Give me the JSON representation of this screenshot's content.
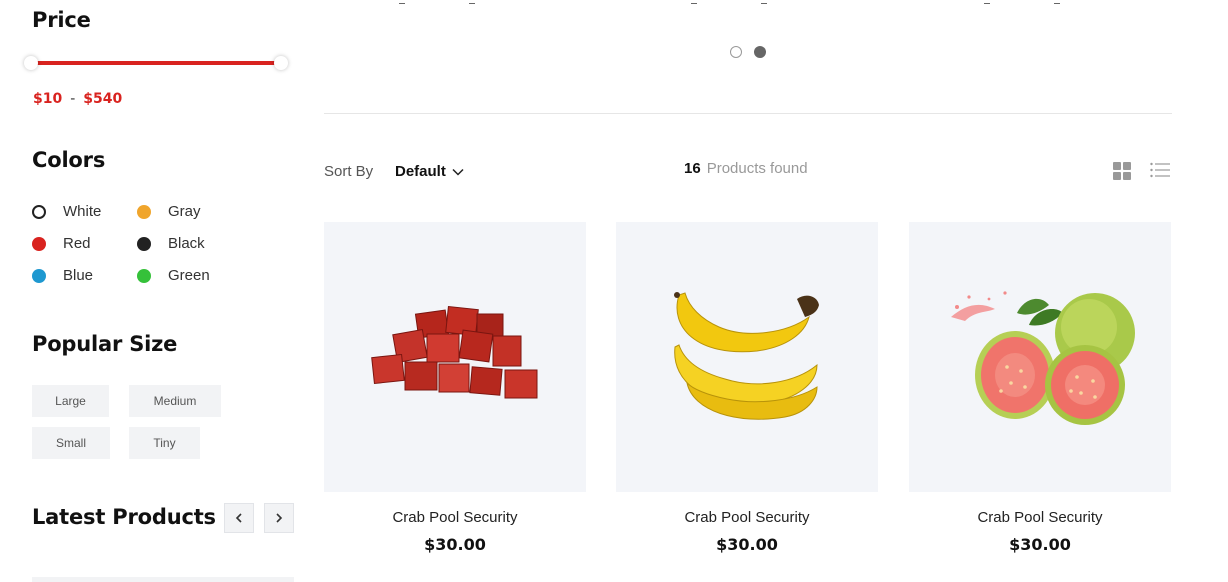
{
  "sidebar": {
    "price": {
      "title": "Price",
      "min_label": "$10",
      "separator": "-",
      "max_label": "$540",
      "accent_color": "#d9231f"
    },
    "colors": {
      "title": "Colors",
      "items": [
        {
          "label": "White",
          "hex": "#ffffff"
        },
        {
          "label": "Gray",
          "hex": "#f0a52c"
        },
        {
          "label": "Red",
          "hex": "#d9231f"
        },
        {
          "label": "Black",
          "hex": "#222222"
        },
        {
          "label": "Blue",
          "hex": "#1e98d0"
        },
        {
          "label": "Green",
          "hex": "#35c13a"
        }
      ]
    },
    "sizes": {
      "title": "Popular Size",
      "items": [
        "Large",
        "Medium",
        "Small",
        "Tiny"
      ]
    },
    "latest": {
      "title": "Latest Products",
      "prev_icon": "chevron-left-icon",
      "next_icon": "chevron-right-icon"
    }
  },
  "main": {
    "carousel_dots": 2,
    "carousel_active": 2,
    "sort": {
      "label": "Sort By",
      "value": "Default"
    },
    "products_found": {
      "count": "16",
      "label": "Products found"
    },
    "view_icons": [
      "grid-view-icon",
      "list-view-icon"
    ],
    "products": [
      {
        "name": "Crab Pool Security",
        "price": "$30.00",
        "image": "meat-cubes"
      },
      {
        "name": "Crab Pool Security",
        "price": "$30.00",
        "image": "bananas"
      },
      {
        "name": "Crab Pool Security",
        "price": "$30.00",
        "image": "guava"
      }
    ]
  }
}
